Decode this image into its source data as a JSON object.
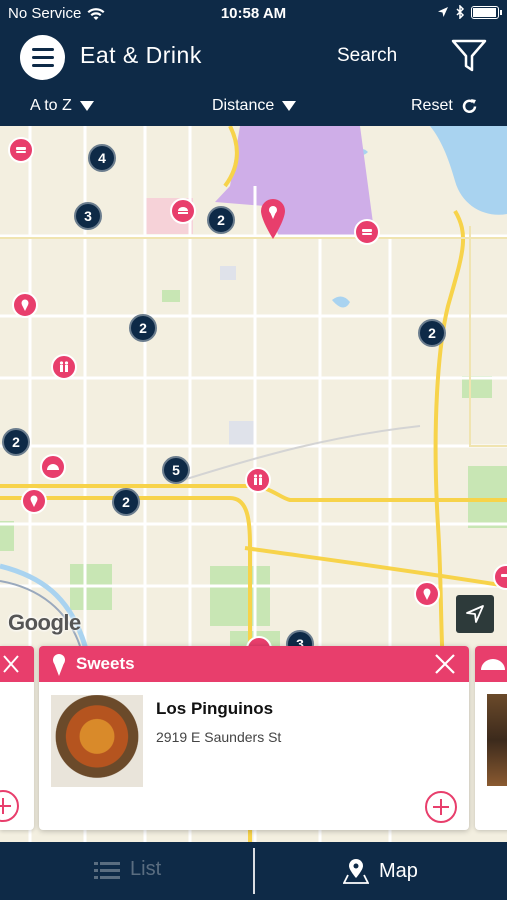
{
  "status_bar": {
    "carrier": "No Service",
    "time": "10:58 AM",
    "battery_level": 0.95
  },
  "header": {
    "title": "Eat & Drink",
    "search_label": "Search"
  },
  "sort_bar": {
    "alpha_label": "A to Z",
    "distance_label": "Distance",
    "reset_label": "Reset"
  },
  "map": {
    "clusters": [
      "4",
      "3",
      "2",
      "2",
      "2",
      "2",
      "5",
      "2",
      "3"
    ],
    "attribution": "Google"
  },
  "card": {
    "category": "Sweets",
    "place_name": "Los Pinguinos",
    "address": "2919 E Saunders St"
  },
  "tabs": {
    "list_label": "List",
    "map_label": "Map"
  },
  "colors": {
    "navy": "#0e2a47",
    "accent": "#e83e6c",
    "map_bg": "#f3efe0"
  }
}
